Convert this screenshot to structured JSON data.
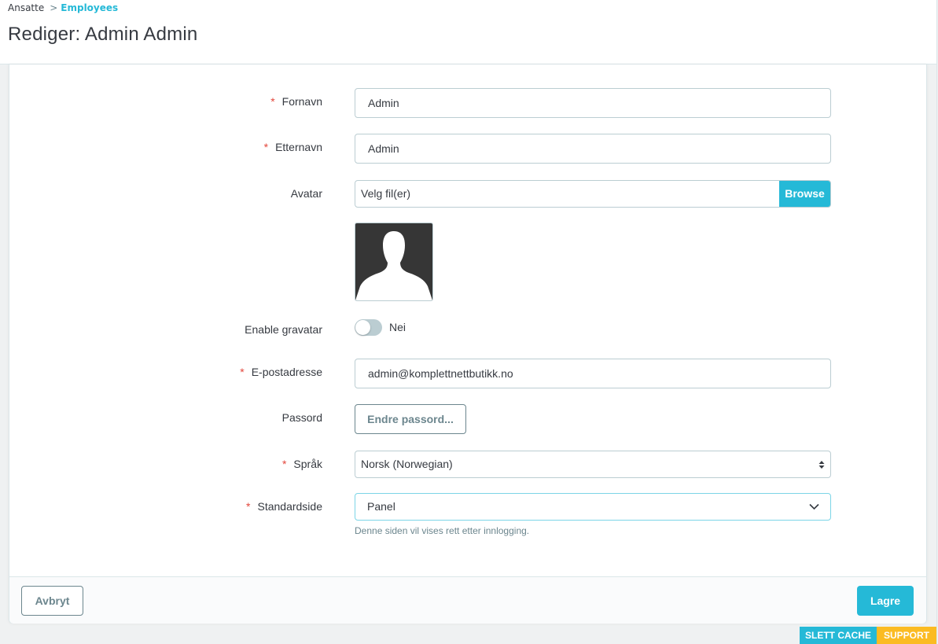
{
  "breadcrumb": {
    "parent": "Ansatte",
    "separator": ">",
    "current": "Employees"
  },
  "page_title": "Rediger: Admin Admin",
  "form": {
    "required_marker": "*",
    "firstname": {
      "label": "Fornavn",
      "value": "Admin",
      "required": true
    },
    "lastname": {
      "label": "Etternavn",
      "value": "Admin",
      "required": true
    },
    "avatar": {
      "label": "Avatar",
      "file_placeholder": "Velg fil(er)",
      "browse_label": "Browse",
      "image_icon": "default-user-silhouette"
    },
    "gravatar": {
      "label": "Enable gravatar",
      "state_label": "Nei",
      "enabled": false
    },
    "email": {
      "label": "E-postadresse",
      "value": "admin@komplettnettbutikk.no",
      "required": true
    },
    "password": {
      "label": "Passord",
      "button_label": "Endre passord..."
    },
    "language": {
      "label": "Språk",
      "value": "Norsk (Norwegian)",
      "required": true
    },
    "default_page": {
      "label": "Standardside",
      "value": "Panel",
      "required": true,
      "help": "Denne siden vil vises rett etter innlogging."
    }
  },
  "footer": {
    "cancel_label": "Avbryt",
    "save_label": "Lagre"
  },
  "bottom_bar": {
    "clear_cache": "SLETT CACHE",
    "support": "SUPPORT"
  },
  "colors": {
    "accent": "#25b9d7",
    "required": "#e3463b",
    "support": "#fbbb22",
    "text": "#363a41",
    "muted": "#6c868e",
    "border": "#bbcdd2"
  }
}
